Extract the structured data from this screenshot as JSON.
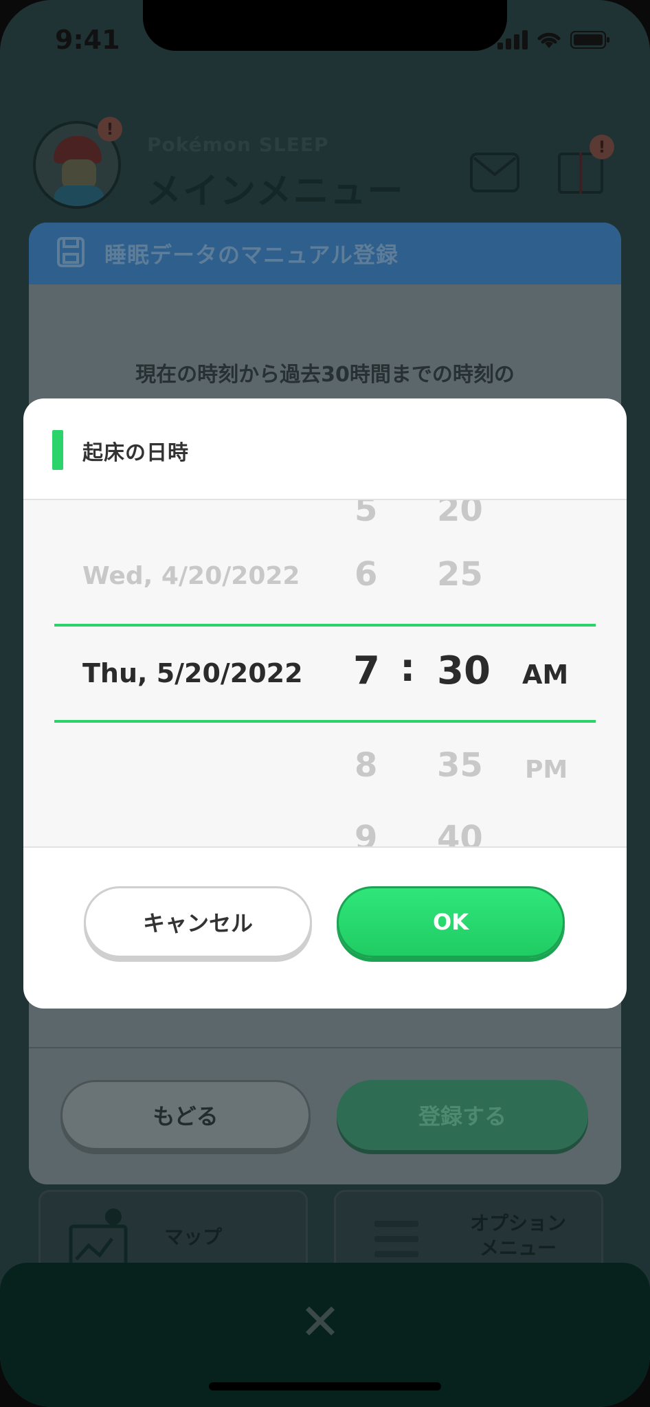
{
  "status_bar": {
    "time": "9:41"
  },
  "app": {
    "subtitle": "Pokémon SLEEP",
    "title": "メインメニュー",
    "avatar_badge": "!",
    "gift_badge": "!"
  },
  "panel": {
    "header_title": "睡眠データのマニュアル登録",
    "body_text": "現在の時刻から過去30時間までの時刻の",
    "back_label": "もどる",
    "register_label": "登録する"
  },
  "tiles": {
    "map_label": "マップ",
    "options_label_line1": "オプション",
    "options_label_line2": "メニュー"
  },
  "modal": {
    "title": "起床の日時",
    "picker": {
      "date_above": "Wed, 4/20/2022",
      "date_selected": "Thu, 5/20/2022",
      "hours": [
        "5",
        "6",
        "7",
        "8",
        "9"
      ],
      "minutes": [
        "20",
        "25",
        "30",
        "35",
        "40"
      ],
      "separator": ":",
      "period_selected": "AM",
      "period_below": "PM"
    },
    "cancel_label": "キャンセル",
    "ok_label": "OK"
  },
  "colors": {
    "accent_green": "#2ad46a",
    "panel_header_blue": "#2f5f8c"
  }
}
